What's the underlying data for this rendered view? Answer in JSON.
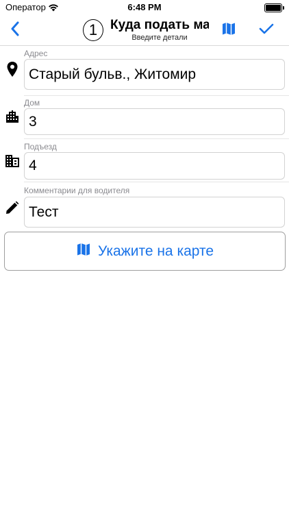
{
  "status_bar": {
    "carrier": "Оператор",
    "time": "6:48 PM"
  },
  "nav": {
    "step_number": "1",
    "title": "Куда подать машину",
    "subtitle": "Введите детали",
    "icons": {
      "back": "chevron-left-icon",
      "map": "map-icon",
      "done": "checkmark-icon"
    },
    "accent_color": "#1a73e8"
  },
  "form": {
    "address": {
      "label": "Адрес",
      "value": "Старый бульв., Житомир",
      "icon": "location-pin-icon"
    },
    "house": {
      "label": "Дом",
      "value": "3",
      "icon": "building-icon"
    },
    "entrance": {
      "label": "Подъезд",
      "value": "4",
      "icon": "office-building-icon"
    },
    "comment": {
      "label": "Комментарии для водителя",
      "value": "Тест",
      "icon": "pencil-icon"
    }
  },
  "map_cta": {
    "label": "Укажите на карте",
    "icon": "map-icon"
  }
}
